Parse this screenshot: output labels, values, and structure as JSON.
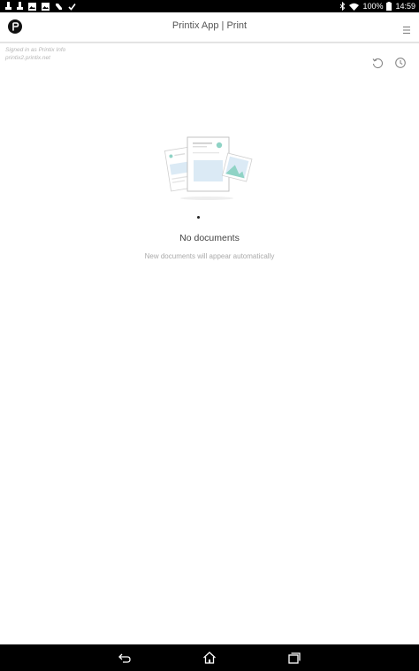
{
  "status_bar": {
    "left_icons": [
      "notification-icon",
      "notification-icon",
      "image-icon",
      "image-icon",
      "n-app-icon",
      "check-icon"
    ],
    "right_icons": [
      "bluetooth-icon",
      "wifi-icon",
      "battery-icon"
    ],
    "battery": "100%",
    "time": "14:59"
  },
  "header": {
    "title": "Printix App | Print",
    "logo_icon": "printix-logo-icon",
    "menu_icon": "menu-icon"
  },
  "account": {
    "signed_in": "Signed in as Printix Info",
    "domain": "printix2.printix.net"
  },
  "toolbar": {
    "refresh_icon": "refresh-icon",
    "history_icon": "history-icon"
  },
  "empty_state": {
    "title": "No documents",
    "subtitle": "New documents will appear automatically"
  },
  "nav_bar": {
    "back_icon": "back-icon",
    "home_icon": "home-icon",
    "recents_icon": "recents-icon"
  },
  "colors": {
    "accent": "#8fd3c5",
    "illustration_blue": "#dbeaf5",
    "header_border": "#e3e3e3",
    "status_bg": "#000000"
  }
}
